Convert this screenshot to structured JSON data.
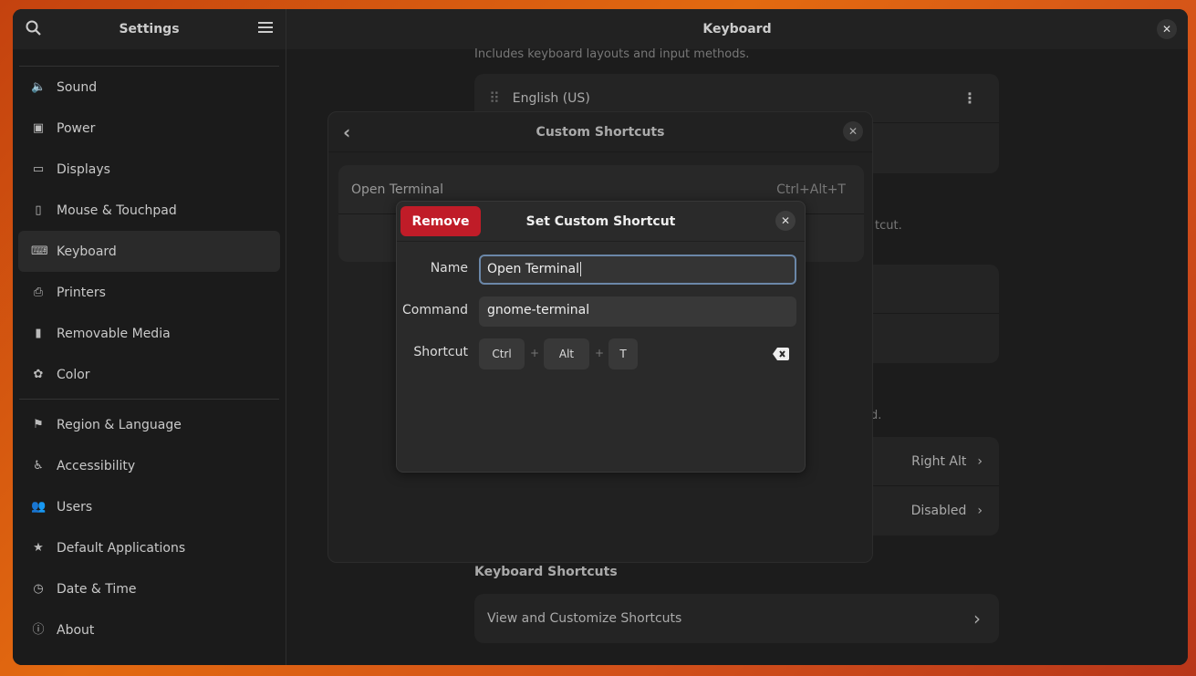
{
  "sidebar": {
    "title": "Settings",
    "items": [
      {
        "label": "Sound",
        "icon": "speaker-icon"
      },
      {
        "label": "Power",
        "icon": "battery-icon"
      },
      {
        "label": "Displays",
        "icon": "display-icon"
      },
      {
        "label": "Mouse & Touchpad",
        "icon": "mouse-icon"
      },
      {
        "label": "Keyboard",
        "icon": "keyboard-icon"
      },
      {
        "label": "Printers",
        "icon": "printer-icon"
      },
      {
        "label": "Removable Media",
        "icon": "usb-icon"
      },
      {
        "label": "Color",
        "icon": "color-icon"
      },
      {
        "label": "Region & Language",
        "icon": "flag-icon"
      },
      {
        "label": "Accessibility",
        "icon": "accessibility-icon"
      },
      {
        "label": "Users",
        "icon": "users-icon"
      },
      {
        "label": "Default Applications",
        "icon": "star-icon"
      },
      {
        "label": "Date & Time",
        "icon": "clock-icon"
      },
      {
        "label": "About",
        "icon": "info-icon"
      }
    ]
  },
  "main": {
    "title": "Keyboard",
    "input_desc": "Includes keyboard layouts and input methods.",
    "layout": "English (US)",
    "partial1": "tcut.",
    "partial2": "d.",
    "alt_value": "Right Alt",
    "compose_value": "Disabled",
    "shortcuts_heading": "Keyboard Shortcuts",
    "view_shortcuts": "View and Customize Shortcuts"
  },
  "custom_dialog": {
    "title": "Custom Shortcuts",
    "row_name": "Open Terminal",
    "row_shortcut": "Ctrl+Alt+T"
  },
  "set_dialog": {
    "title": "Set Custom Shortcut",
    "remove": "Remove",
    "name_label": "Name",
    "name_value": "Open Terminal",
    "command_label": "Command",
    "command_value": "gnome-terminal",
    "shortcut_label": "Shortcut",
    "keys": [
      "Ctrl",
      "Alt",
      "T"
    ],
    "plus": "+"
  },
  "colors": {
    "destructive": "#c01c28",
    "focus": "#6b87a8"
  }
}
